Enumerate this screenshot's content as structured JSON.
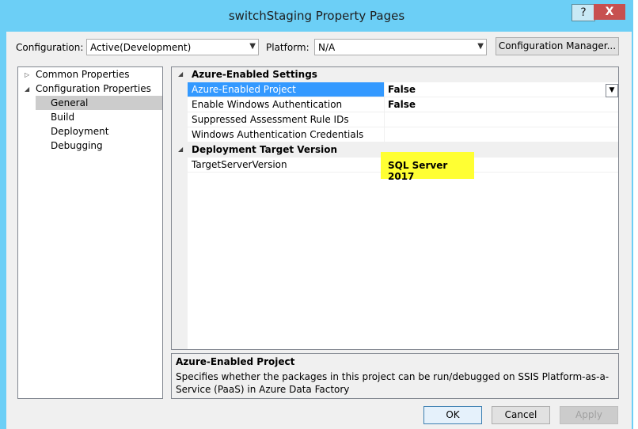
{
  "window": {
    "title": "switchStaging Property Pages",
    "help_label": "?",
    "close_label": "X"
  },
  "toolbar": {
    "configuration_label": "Configuration:",
    "configuration_value": "Active(Development)",
    "platform_label": "Platform:",
    "platform_value": "N/A",
    "config_manager_label": "Configuration Manager..."
  },
  "tree": {
    "items": [
      {
        "label": "Common Properties",
        "expanded": false
      },
      {
        "label": "Configuration Properties",
        "expanded": true
      },
      {
        "label": "General",
        "selected": true
      },
      {
        "label": "Build"
      },
      {
        "label": "Deployment"
      },
      {
        "label": "Debugging"
      }
    ]
  },
  "grid": {
    "categories": [
      {
        "label": "Azure-Enabled Settings",
        "rows": [
          {
            "name": "Azure-Enabled Project",
            "value": "False",
            "selected": true
          },
          {
            "name": "Enable Windows Authentication",
            "value": "False"
          },
          {
            "name": "Suppressed Assessment Rule IDs",
            "value": ""
          },
          {
            "name": "Windows Authentication Credentials",
            "value": ""
          }
        ]
      },
      {
        "label": "Deployment Target Version",
        "rows": [
          {
            "name": "TargetServerVersion",
            "value": "SQL Server 2017"
          }
        ]
      }
    ]
  },
  "description": {
    "title": "Azure-Enabled Project",
    "text": "Specifies whether the packages in this project can be run/debugged on SSIS Platform-as-a-Service (PaaS) in Azure Data Factory"
  },
  "buttons": {
    "ok": "OK",
    "cancel": "Cancel",
    "apply": "Apply"
  },
  "colors": {
    "titlebar": "#6ccff6",
    "selection": "#3399ff",
    "highlight": "#ffff33"
  }
}
